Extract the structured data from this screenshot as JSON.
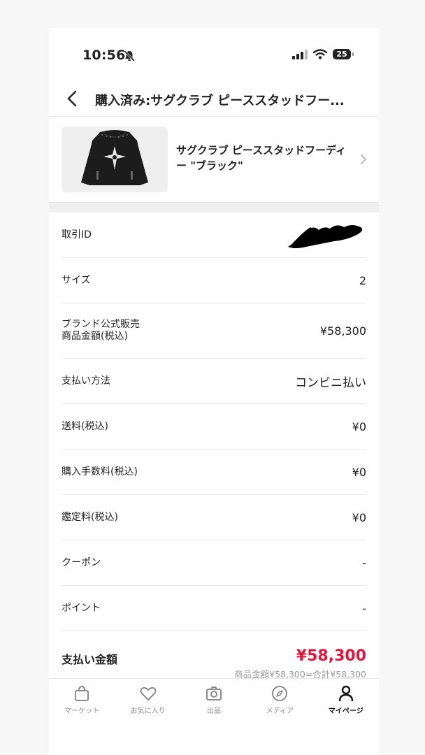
{
  "status_bar": {
    "time": "10:56",
    "battery": "25"
  },
  "header": {
    "title": "購入済み:サグクラブ ピーススタッドフー..."
  },
  "product": {
    "name": "サグクラブ ピーススタッドフーディー \"ブラック\""
  },
  "details": [
    {
      "label": "取引ID",
      "value": ""
    },
    {
      "label": "サイズ",
      "value": "2"
    },
    {
      "label": "ブランド公式販売\n商品金額(税込)",
      "value": "¥58,300"
    },
    {
      "label": "支払い方法",
      "value": "コンビニ払い"
    },
    {
      "label": "送料(税込)",
      "value": "¥0"
    },
    {
      "label": "購入手数料(税込)",
      "value": "¥0"
    },
    {
      "label": "鑑定料(税込)",
      "value": "¥0"
    },
    {
      "label": "クーポン",
      "value": "-"
    },
    {
      "label": "ポイント",
      "value": "-"
    }
  ],
  "total": {
    "label": "支払い金額",
    "amount": "¥58,300",
    "breakdown": "商品金額¥58,300=合計¥58,300"
  },
  "accent_color": "#e0163d",
  "tabbar": {
    "tabs": [
      {
        "label": "マーケット",
        "icon": "bag-icon"
      },
      {
        "label": "お気に入り",
        "icon": "heart-icon"
      },
      {
        "label": "出品",
        "icon": "camera-icon"
      },
      {
        "label": "メディア",
        "icon": "compass-icon"
      },
      {
        "label": "マイページ",
        "icon": "person-icon"
      }
    ],
    "active_index": 4
  }
}
